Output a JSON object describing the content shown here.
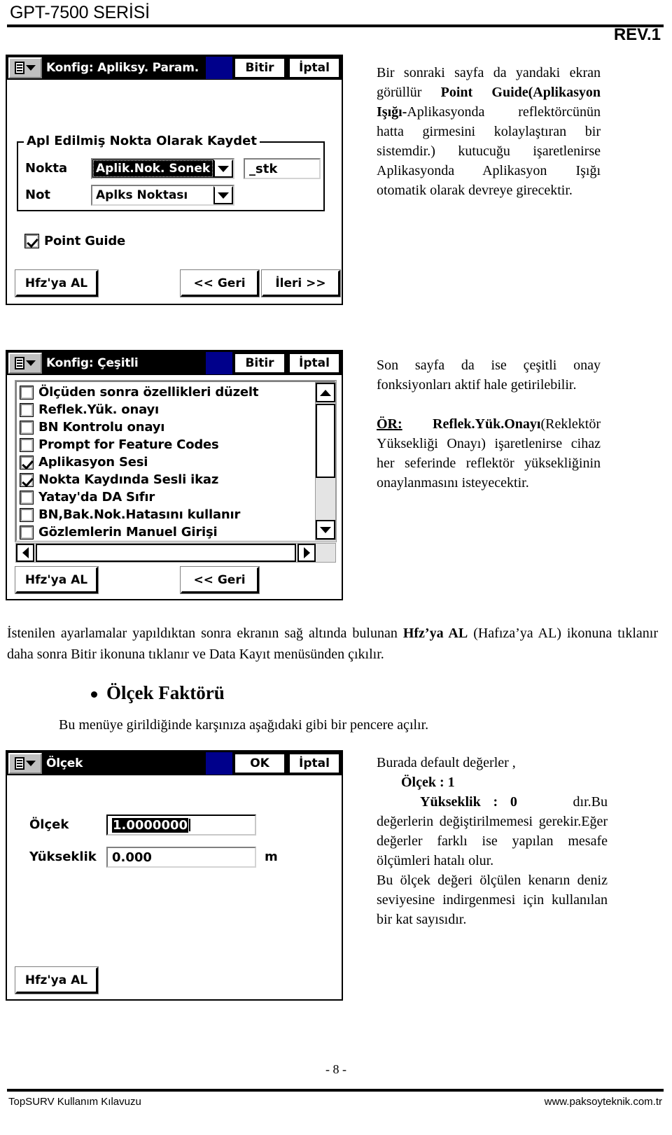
{
  "header": {
    "title": "GPT-7500 SERİSİ",
    "revision": "REV.1"
  },
  "footer": {
    "page_number": "- 8 -",
    "left": "TopSURV Kullanım Kılavuzu",
    "right": "www.paksoyteknik.com.tr"
  },
  "dialog1": {
    "title": "Konfig: Apliksy. Param.",
    "icon": "menu-list-icon",
    "title_buttons": {
      "ok": "Bitir",
      "cancel": "İptal"
    },
    "groupbox_legend": "Apl Edilmiş Nokta Olarak Kaydet",
    "fields": [
      {
        "label": "Nokta",
        "combo_value": "Aplik.Nok. Sonek",
        "selected": true,
        "suffix_value": "_stk"
      },
      {
        "label": "Not",
        "combo_value": "Aplks Noktası",
        "selected": false
      }
    ],
    "checkbox": {
      "label": "Point Guide",
      "checked": true
    },
    "buttons": {
      "store": "Hfz'ya AL",
      "back": "<< Geri",
      "next": "İleri >>"
    }
  },
  "dialog2": {
    "title": "Konfig: Çeşitli",
    "icon": "menu-list-icon",
    "title_buttons": {
      "ok": "Bitir",
      "cancel": "İptal"
    },
    "list_items": [
      {
        "label": "Ölçüden sonra özellikleri düzelt",
        "checked": false
      },
      {
        "label": "Reflek.Yük. onayı",
        "checked": false
      },
      {
        "label": "BN Kontrolu onayı",
        "checked": false
      },
      {
        "label": "Prompt for Feature Codes",
        "checked": false
      },
      {
        "label": "Aplikasyon Sesi",
        "checked": true
      },
      {
        "label": "Nokta Kaydında Sesli ikaz",
        "checked": true
      },
      {
        "label": "Yatay'da DA Sıfır",
        "checked": false
      },
      {
        "label": "BN,Bak.Nok.Hatasını kullanır",
        "checked": false
      },
      {
        "label": "Gözlemlerin Manuel Girişi",
        "checked": false
      }
    ],
    "buttons": {
      "store": "Hfz'ya AL",
      "back": "<< Geri"
    }
  },
  "dialog3": {
    "title": "Ölçek",
    "icon": "menu-list-icon",
    "title_buttons": {
      "ok": "OK",
      "cancel": "İptal"
    },
    "fields": [
      {
        "label": "Ölçek",
        "value": "1.0000000",
        "selected": true,
        "unit": ""
      },
      {
        "label": "Yükseklik",
        "value": "0.000",
        "selected": false,
        "unit": "m"
      }
    ],
    "buttons": {
      "store": "Hfz'ya AL"
    }
  },
  "text": {
    "para1_html": "Bir sonraki sayfa da yandaki ekran görüllür <b>Point Guide(Aplikasyon Işığı-</b>Aplikasyonda reflektörcünün hatta girmesini kolaylaştıran bir sistemdir.) kutucuğu işaretlenirse Aplikasyonda Aplikasyon Işığı otomatik olarak devreye girecektir.",
    "para2_html": "Son sayfa da ise çeşitli onay fonksiyonları aktif hale getirilebilir.<br><br><b><u>ÖR:</u></b>&nbsp; <b>Reflek.Yük.Onayı</b>(Reklektör Yüksekliği Onayı) işaretlenirse cihaz her seferinde reflektör yüksekliğinin onaylanmasını isteyecektir.",
    "para_wide_html": "İstenilen ayarlamalar yapıldıktan sonra ekranın sağ altında bulunan <b>Hfz’ya AL</b> (Hafıza’ya AL) ikonuna tıklanır daha sonra Bitir ikonuna tıklanır ve Data Kayıt menüsünden çıkılır.",
    "bullet_heading": "Ölçek Faktörü",
    "subpara": "Bu menüye girildiğinde karşınıza aşağıdaki gibi bir pencere açılır.",
    "para3_html": "Burada default değerler ,<br>&nbsp;&nbsp;&nbsp;&nbsp;&nbsp;&nbsp;&nbsp;<b>Ölçek : 1</b><br>&nbsp;&nbsp;&nbsp;&nbsp;&nbsp;&nbsp;&nbsp;<b>Yükseklik&nbsp; : &nbsp;0</b>&nbsp;&nbsp;&nbsp;&nbsp;&nbsp;&nbsp;&nbsp;&nbsp;&nbsp;dır.Bu değerlerin değiştirilmemesi gerekir.Eğer değerler farklı ise yapılan mesafe ölçümleri hatalı olur.<br>Bu ölçek değeri ölçülen kenarın deniz seviyesine indirgenmesi için kullanılan bir kat sayısıdır."
  }
}
